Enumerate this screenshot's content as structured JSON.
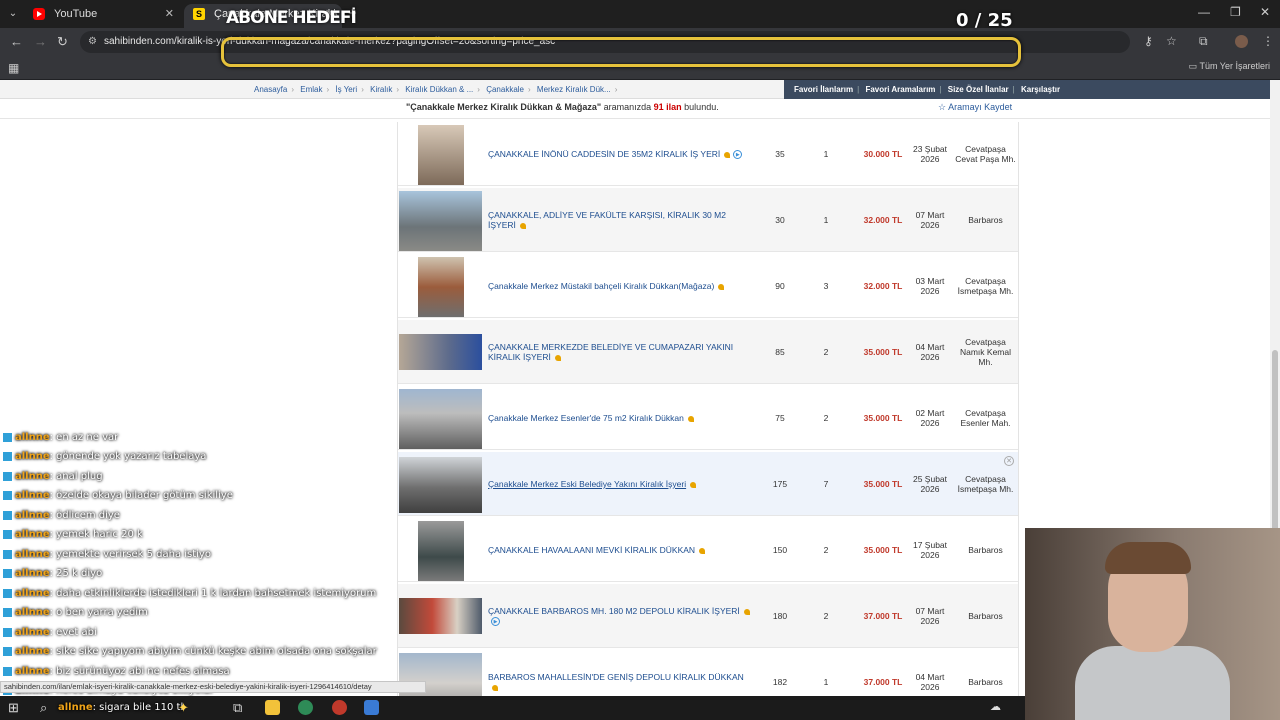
{
  "browser": {
    "tabs": [
      {
        "title": "YouTube"
      },
      {
        "title": "Çanakkale Merkez Kiralık Dükka"
      }
    ],
    "url": "sahibinden.com/kiralik-is-yeri-dukkan-magaza/canakkale-merkez?pagingOffset=20&sorting=price_asc",
    "bookmarks_all": "Tüm Yer İşaretleri"
  },
  "overlay": {
    "goal_label": "ABONE HEDEFİ",
    "goal_counter": "0 / 25"
  },
  "breadcrumbs": [
    "Anasayfa",
    "Emlak",
    "İş Yeri",
    "Kiralık",
    "Kiralık Dükkan & ...",
    "Çanakkale",
    "Merkez Kiralık Dük..."
  ],
  "favbar": [
    "Favori İlanlarım",
    "Favori Aramalarım",
    "Size Özel İlanlar",
    "Karşılaştır"
  ],
  "search_summary": {
    "query": "\"Çanakkale Merkez Kiralık Dükkan & Mağaza\"",
    "middle": " aramanızda ",
    "count": "91 ilan",
    "suffix": " bulundu.",
    "save_search": "☆ Aramayı Kaydet"
  },
  "listings": [
    {
      "title": "ÇANAKKALE İNÖNÜ CADDESİN DE 35M2 KİRALIK İŞ YERİ",
      "m2": "35",
      "rooms": "1",
      "price": "30.000 TL",
      "date": "23 Şubat 2026",
      "location": "Cevatpaşa Cevat Paşa Mh."
    },
    {
      "title": "ÇANAKKALE, ADLİYE VE FAKÜLTE KARŞISI, KİRALIK 30 M2 İŞYERİ",
      "m2": "30",
      "rooms": "1",
      "price": "32.000 TL",
      "date": "07 Mart 2026",
      "location": "Barbaros"
    },
    {
      "title": "Çanakkale Merkez Müstakil bahçeli Kiralık Dükkan(Mağaza)",
      "m2": "90",
      "rooms": "3",
      "price": "32.000 TL",
      "date": "03 Mart 2026",
      "location": "Cevatpaşa İsmetpaşa Mh."
    },
    {
      "title": "ÇANAKKALE MERKEZDE BELEDİYE VE CUMAPAZARI YAKINI KİRALIK İŞYERİ",
      "m2": "85",
      "rooms": "2",
      "price": "35.000 TL",
      "date": "04 Mart 2026",
      "location": "Cevatpaşa Namık Kemal Mh."
    },
    {
      "title": "Çanakkale Merkez Esenler'de 75 m2 Kiralık Dükkan",
      "m2": "75",
      "rooms": "2",
      "price": "35.000 TL",
      "date": "02 Mart 2026",
      "location": "Cevatpaşa Esenler Mah."
    },
    {
      "title": "Çanakkale Merkez Eski Belediye Yakını Kiralık İşyeri",
      "m2": "175",
      "rooms": "7",
      "price": "35.000 TL",
      "date": "25 Şubat 2026",
      "location": "Cevatpaşa İsmetpaşa Mh."
    },
    {
      "title": "ÇANAKKALE HAVAALAANI MEVKİ KİRALIK DÜKKAN",
      "m2": "150",
      "rooms": "2",
      "price": "35.000 TL",
      "date": "17 Şubat 2026",
      "location": "Barbaros"
    },
    {
      "title": "ÇANAKKALE BARBAROS MH. 180 M2 DEPOLU KİRALIK İŞYERİ",
      "m2": "180",
      "rooms": "2",
      "price": "37.000 TL",
      "date": "07 Mart 2026",
      "location": "Barbaros"
    },
    {
      "title": "BARBAROS MAHALLESİN'DE GENİŞ DEPOLU KİRALIK DÜKKAN",
      "m2": "182",
      "rooms": "1",
      "price": "37.000 TL",
      "date": "04 Mart 2026",
      "location": "Barbaros"
    }
  ],
  "chat": [
    {
      "user": "allnne",
      "text": ": en az ne var"
    },
    {
      "user": "allnne",
      "text": ": gönende yok yazarız tabelaya"
    },
    {
      "user": "allnne",
      "text": ": anal plug"
    },
    {
      "user": "allnne",
      "text": ": özelde okaya bilader götüm sikiliye"
    },
    {
      "user": "allnne",
      "text": ": ödlicem diye"
    },
    {
      "user": "allnne",
      "text": ": yemek haric 20 k"
    },
    {
      "user": "allnne",
      "text": ": yemekte verirsek 5 daha istiyo"
    },
    {
      "user": "allnne",
      "text": ": 25 k diyo"
    },
    {
      "user": "allnne",
      "text": ": daha etkinliklerde istedikleri 1 k lardan bahsetmek istemiyorum"
    },
    {
      "user": "allnne",
      "text": ": o ben yarra yedim"
    },
    {
      "user": "allnne",
      "text": ": evet abi"
    },
    {
      "user": "allnne",
      "text": ": sike sike yapıyom abiyim cünkü keşke abim olsada ona sokşalar"
    },
    {
      "user": "allnne",
      "text": ": biz sürünüyoz abi ne nefes almasa"
    },
    {
      "user": "allnne",
      "text": ": nefes almaya calisiyoz sikiyolar"
    },
    {
      "user": "allnne",
      "text": ": sigara bile 110 tl"
    }
  ],
  "status_url": "sahibinden.com/ilan/emlak-isyeri-kiralik-canakkale-merkez-eski-belediye-yakini-kiralik-isyeri-1296414610/detay",
  "colors": {
    "price": "#c0392b",
    "link": "#1d4d8f",
    "favbar": "#3b4a5f"
  }
}
